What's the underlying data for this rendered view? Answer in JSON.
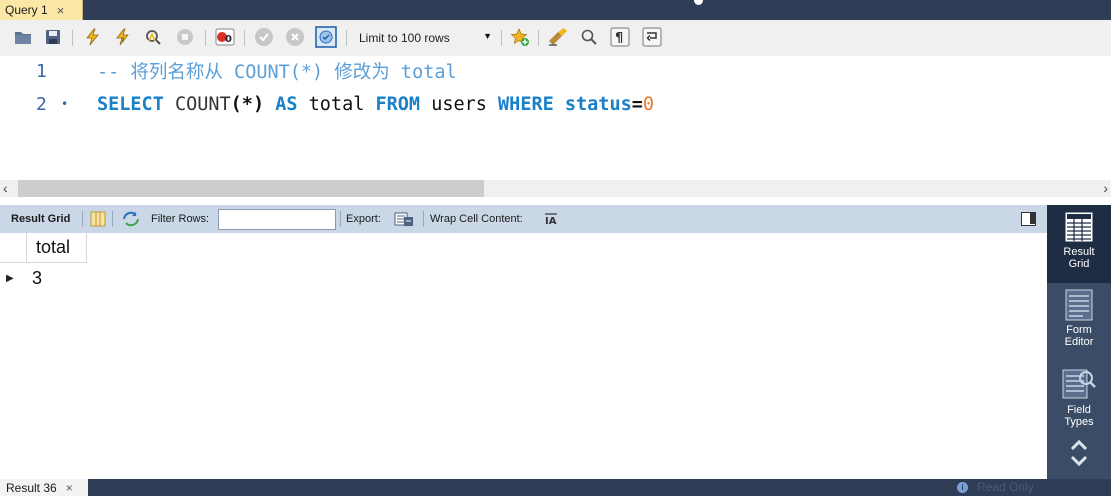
{
  "tab": {
    "label": "Query 1",
    "close": "×"
  },
  "toolbar": {
    "limit_select": "Limit to 100 rows",
    "icons": [
      "open-folder-icon",
      "save-icon",
      "execute-icon",
      "execute-current-icon",
      "explain-icon",
      "stop-icon",
      "toggle-error-icon",
      "commit-icon",
      "rollback-icon",
      "autocommit-icon",
      "beautify-icon",
      "find-icon",
      "invisible-chars-icon",
      "wrap-icon"
    ]
  },
  "editor": {
    "lines": [
      {
        "num": "1",
        "bullet": "",
        "comment": "-- 将列名称从 COUNT(*) 修改为 total"
      },
      {
        "num": "2",
        "bullet": "•"
      }
    ],
    "line2": {
      "kw_select": "SELECT",
      "fn_count": "COUNT",
      "paren": "(*)",
      "kw_as": "AS",
      "alias": "total",
      "kw_from": "FROM",
      "table": "users",
      "kw_where": "WHERE",
      "column": "status",
      "eq": "=",
      "value": "0"
    }
  },
  "results_toolbar": {
    "result_grid": "Result Grid",
    "filter_label": "Filter Rows:",
    "filter_value": "",
    "export_label": "Export:",
    "wrap_label": "Wrap Cell Content:"
  },
  "grid": {
    "columns": [
      "total"
    ],
    "rows": [
      [
        "3"
      ]
    ]
  },
  "side_panel": {
    "items": [
      {
        "label_1": "Result",
        "label_2": "Grid",
        "active": true
      },
      {
        "label_1": "Form",
        "label_2": "Editor",
        "active": false
      },
      {
        "label_1": "Field",
        "label_2": "Types",
        "active": false
      }
    ]
  },
  "bottom": {
    "tab_label": "Result 36",
    "close": "×",
    "status": "Read Only"
  },
  "colors": {
    "accent_tab": "#fbe7a6",
    "dark_bar": "#2f3d57",
    "keyword": "#1a80c8",
    "comment": "#5a9fd8",
    "number": "#e8792b"
  }
}
